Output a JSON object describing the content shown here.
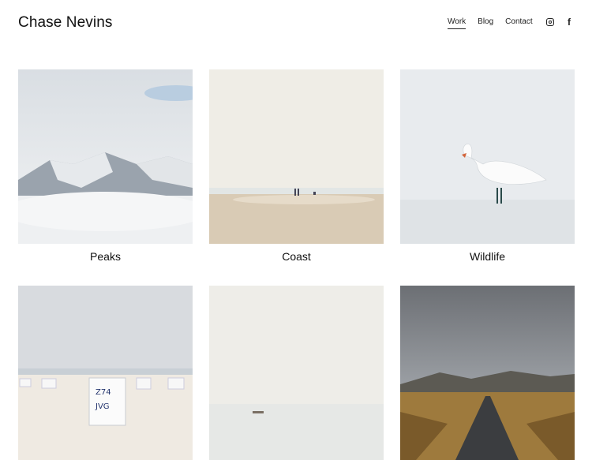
{
  "site": {
    "title": "Chase Nevins"
  },
  "nav": {
    "items": [
      {
        "label": "Work",
        "active": true
      },
      {
        "label": "Blog",
        "active": false
      },
      {
        "label": "Contact",
        "active": false
      }
    ]
  },
  "social": {
    "icons": [
      "instagram-icon",
      "facebook-icon"
    ]
  },
  "gallery": {
    "items": [
      {
        "title": "Peaks"
      },
      {
        "title": "Coast"
      },
      {
        "title": "Wildlife"
      },
      {
        "title": ""
      },
      {
        "title": ""
      },
      {
        "title": ""
      }
    ]
  }
}
